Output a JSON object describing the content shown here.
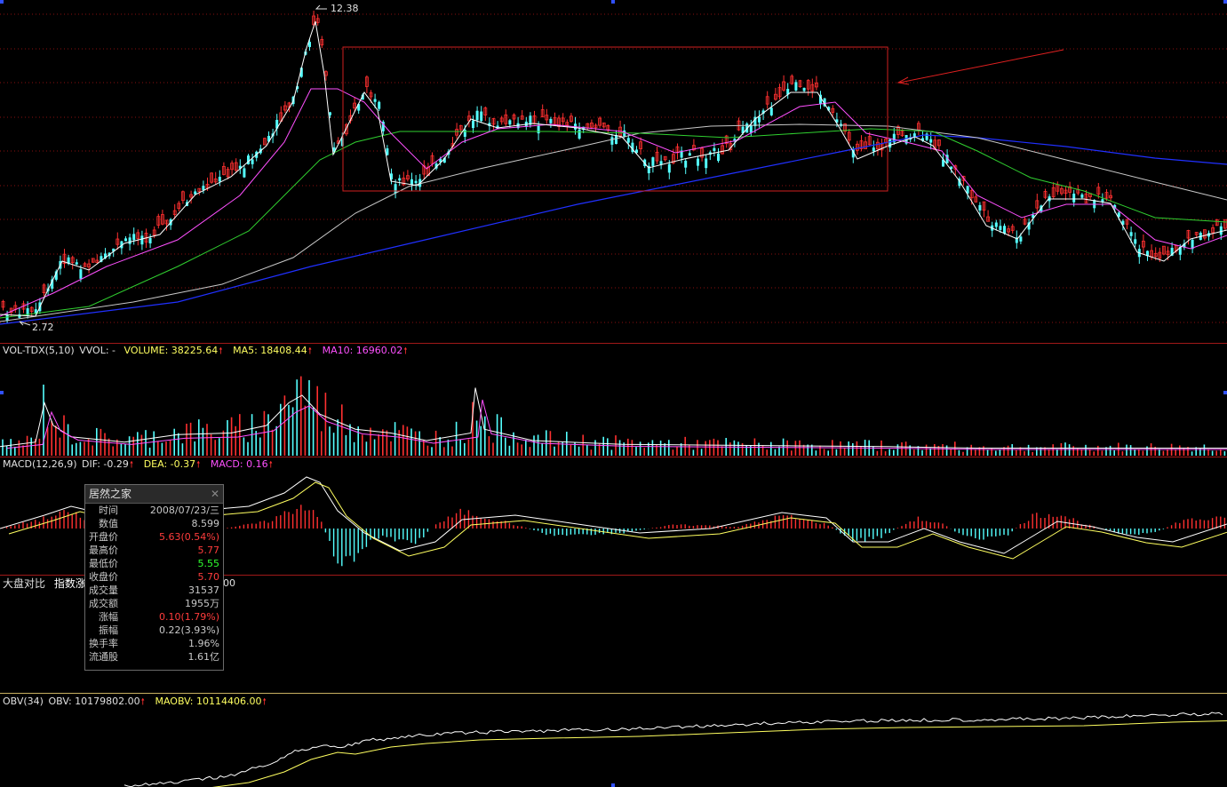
{
  "price_labels": {
    "high": "12.38",
    "low": "2.72"
  },
  "vol": {
    "name": "VOL-TDX(5,10)",
    "vvol": "VVOL: -",
    "volume": "VOLUME: 38225.64",
    "ma5": "MA5: 18408.44",
    "ma10": "MA10: 16960.02"
  },
  "macd": {
    "name": "MACD(12,26,9)",
    "dif": "DIF: -0.29",
    "dea": "DEA: -0.37",
    "macd": "MACD: 0.16"
  },
  "compare": {
    "label1": "大盘对比",
    "label2": "指数涨幅",
    "tail": "00"
  },
  "obv": {
    "name": "OBV(34)",
    "obv": "OBV: 10179802.00",
    "maobv": "MAOBV: 10114406.00"
  },
  "popup": {
    "title": "居然之家",
    "rows": [
      {
        "label": "时间",
        "value": "2008/07/23/三"
      },
      {
        "label": "数值",
        "value": "8.599"
      },
      {
        "label": "开盘价",
        "value": "5.63(0.54%)"
      },
      {
        "label": "最高价",
        "value": "5.77"
      },
      {
        "label": "最低价",
        "value": "5.55"
      },
      {
        "label": "收盘价",
        "value": "5.70"
      },
      {
        "label": "成交量",
        "value": "31537"
      },
      {
        "label": "成交额",
        "value": "1955万"
      },
      {
        "label": "涨幅",
        "value": "0.10(1.79%)"
      },
      {
        "label": "振幅",
        "value": "0.22(3.93%)"
      },
      {
        "label": "换手率",
        "value": "1.96%"
      },
      {
        "label": "流通股",
        "value": "1.61亿"
      }
    ]
  },
  "colors": {
    "up": "#ff3030",
    "down": "#54ffff",
    "ma5": "#ffffff",
    "ma10": "#ff50ff",
    "ma20": "#30d030",
    "ma60": "#c8c8c8",
    "ma120": "#2030ff",
    "separator": "#a01818"
  }
}
